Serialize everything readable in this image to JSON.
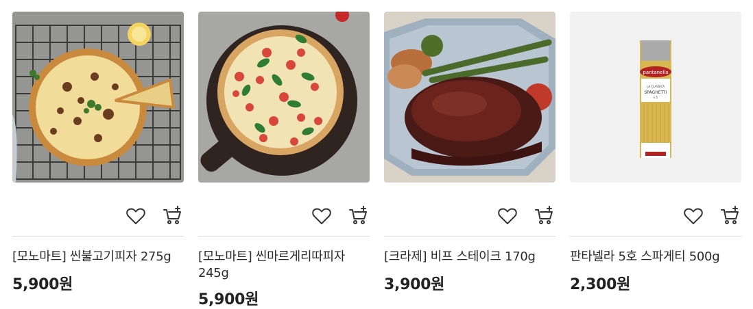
{
  "products": [
    {
      "name": "[모노마트] 씬불고기피자 275g",
      "price": "5,900원",
      "image": "bulgogi-pizza-photo"
    },
    {
      "name": "[모노마트] 씬마르게리따피자 245g",
      "price": "5,900원",
      "image": "margherita-pizza-photo"
    },
    {
      "name": "[크라제] 비프 스테이크 170g",
      "price": "3,900원",
      "image": "beef-steak-photo"
    },
    {
      "name": "판타넬라 5호 스파게티 500g",
      "price": "2,300원",
      "image": "spaghetti-package-photo"
    }
  ],
  "icons": {
    "wishlist": "heart-icon",
    "cart": "cart-icon"
  },
  "package_label": {
    "brand": "pantanella",
    "line": "LA CLASSICA",
    "product": "SPAGHETTI",
    "number": "n.5"
  }
}
